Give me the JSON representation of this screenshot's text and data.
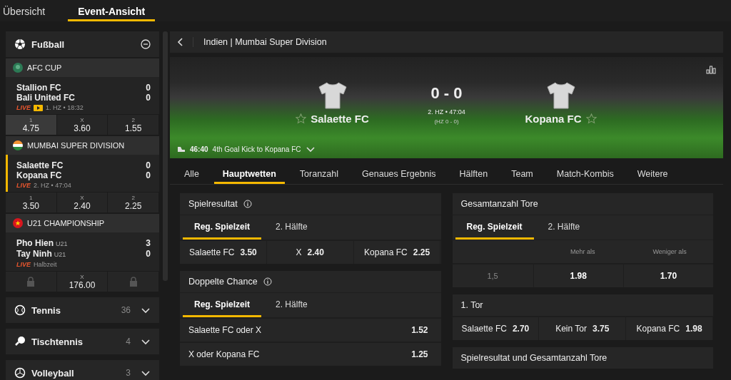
{
  "top_tabs": [
    {
      "label": "Übersicht",
      "selected": false
    },
    {
      "label": "Event-Ansicht",
      "selected": true
    }
  ],
  "sidebar": {
    "sports": [
      {
        "name": "Fußball",
        "kind": "football",
        "expanded": true,
        "leagues": [
          {
            "name": "AFC CUP",
            "kind": "afc",
            "matches": [
              {
                "selected": false,
                "teams": [
                  {
                    "name": "Stallion FC",
                    "score": "0"
                  },
                  {
                    "name": "Bali United FC",
                    "score": "0"
                  }
                ],
                "live": "LIVE",
                "stream": true,
                "status": "1. HZ • 18:32",
                "odds": [
                  {
                    "label": "1",
                    "value": "4.75",
                    "selected": true,
                    "locked": false
                  },
                  {
                    "label": "X",
                    "value": "3.60",
                    "selected": false,
                    "locked": false
                  },
                  {
                    "label": "2",
                    "value": "1.55",
                    "selected": false,
                    "locked": false
                  }
                ]
              }
            ]
          },
          {
            "name": "MUMBAI SUPER DIVISION",
            "kind": "india",
            "matches": [
              {
                "selected": true,
                "teams": [
                  {
                    "name": "Salaette FC",
                    "score": "0"
                  },
                  {
                    "name": "Kopana FC",
                    "score": "0"
                  }
                ],
                "live": "LIVE",
                "stream": false,
                "status": "2. HZ • 47:04",
                "odds": [
                  {
                    "label": "1",
                    "value": "3.50",
                    "selected": false,
                    "locked": false
                  },
                  {
                    "label": "X",
                    "value": "2.40",
                    "selected": false,
                    "locked": false
                  },
                  {
                    "label": "2",
                    "value": "2.25",
                    "selected": false,
                    "locked": false
                  }
                ]
              }
            ]
          },
          {
            "name": "U21 CHAMPIONSHIP",
            "kind": "vietnam",
            "matches": [
              {
                "selected": false,
                "teams": [
                  {
                    "name": "Pho Hien",
                    "tag": "U21",
                    "score": "3"
                  },
                  {
                    "name": "Tay Ninh",
                    "tag": "U21",
                    "score": "0"
                  }
                ],
                "live": "LIVE",
                "stream": false,
                "status": "Halbzeit",
                "odds": [
                  {
                    "selected": false,
                    "locked": true
                  },
                  {
                    "label": "X",
                    "value": "176.00",
                    "selected": false,
                    "locked": false
                  },
                  {
                    "selected": false,
                    "locked": true
                  }
                ]
              }
            ]
          }
        ]
      },
      {
        "name": "Tennis",
        "kind": "tennis",
        "count": "36",
        "expanded": false
      },
      {
        "name": "Tischtennis",
        "kind": "tabletennis",
        "count": "4",
        "expanded": false
      },
      {
        "name": "Volleyball",
        "kind": "volleyball",
        "count": "3",
        "expanded": false
      }
    ]
  },
  "event": {
    "breadcrumb": "Indien | Mumbai Super Division",
    "home": "Salaette FC",
    "away": "Kopana FC",
    "score": "0 - 0",
    "period": "2. HZ • 47:04",
    "halftime": "(HZ 0 - 0)",
    "ticker": {
      "time": "46:40",
      "text": "4th Goal Kick to Kopana FC"
    }
  },
  "market_tabs": [
    {
      "label": "Alle",
      "selected": false
    },
    {
      "label": "Hauptwetten",
      "selected": true
    },
    {
      "label": "Toranzahl",
      "selected": false
    },
    {
      "label": "Genaues Ergebnis",
      "selected": false
    },
    {
      "label": "Hälften",
      "selected": false
    },
    {
      "label": "Team",
      "selected": false
    },
    {
      "label": "Match-Kombis",
      "selected": false
    },
    {
      "label": "Weitere",
      "selected": false
    }
  ],
  "markets": {
    "left": [
      {
        "title": "Spielresultat",
        "info": true,
        "kind": "three_way",
        "subtabs": [
          {
            "label": "Reg. Spielzeit",
            "selected": true
          },
          {
            "label": "2. Hälfte",
            "selected": false
          }
        ],
        "cells": [
          {
            "label": "Salaette FC",
            "value": "3.50"
          },
          {
            "label": "X",
            "value": "2.40"
          },
          {
            "label": "Kopana FC",
            "value": "2.25"
          }
        ]
      },
      {
        "title": "Doppelte Chance",
        "info": true,
        "kind": "list",
        "subtabs": [
          {
            "label": "Reg. Spielzeit",
            "selected": true
          },
          {
            "label": "2. Hälfte",
            "selected": false
          }
        ],
        "cells": [
          {
            "label": "Salaette FC oder X",
            "value": "1.52"
          },
          {
            "label": "X oder Kopana FC",
            "value": "1.25"
          }
        ]
      }
    ],
    "right": [
      {
        "title": "Gesamtanzahl Tore",
        "info": false,
        "kind": "over_under",
        "subtabs": [
          {
            "label": "Reg. Spielzeit",
            "selected": true
          },
          {
            "label": "2. Hälfte",
            "selected": false
          }
        ],
        "headers": [
          "Mehr als",
          "Weniger als"
        ],
        "cells": [
          {
            "label": "1,5",
            "over": "1.98",
            "under": "1.70"
          }
        ]
      },
      {
        "title": "1. Tor",
        "info": false,
        "kind": "three_way",
        "cells": [
          {
            "label": "Salaette FC",
            "value": "2.70"
          },
          {
            "label": "Kein Tor",
            "value": "3.75"
          },
          {
            "label": "Kopana FC",
            "value": "1.98"
          }
        ]
      },
      {
        "title": "Spielresultat und Gesamtanzahl Tore",
        "info": false,
        "kind": "title_only"
      }
    ]
  }
}
